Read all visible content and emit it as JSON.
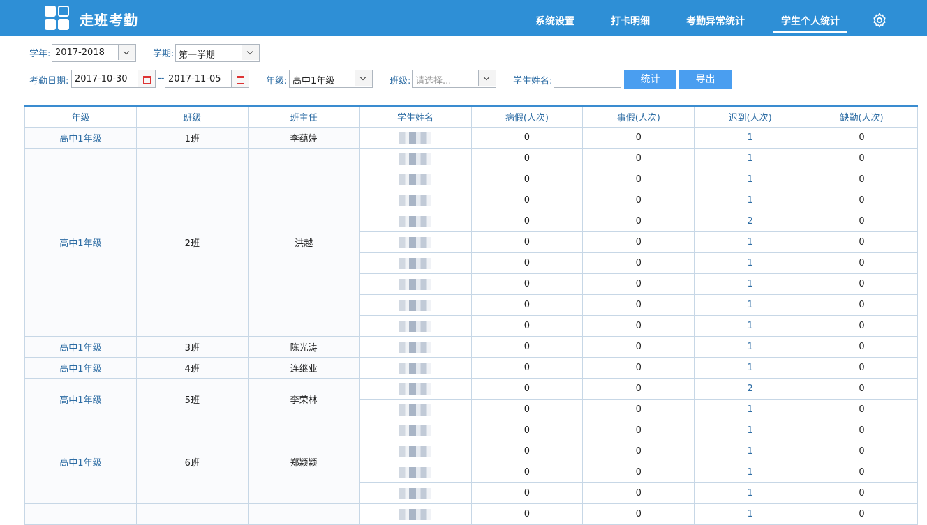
{
  "app": {
    "title": "走班考勤"
  },
  "nav": [
    {
      "label": "系统设置"
    },
    {
      "label": "打卡明细"
    },
    {
      "label": "考勤异常统计"
    },
    {
      "label": "学生个人统计"
    }
  ],
  "filters": {
    "year_label": "学年:",
    "year_value": "2017-2018",
    "term_label": "学期:",
    "term_value": "第一学期",
    "date_label": "考勤日期:",
    "date_start": "2017-10-30",
    "date_sep": "--",
    "date_end": "2017-11-05",
    "grade_label": "年级:",
    "grade_value": "高中1年级",
    "class_label": "班级:",
    "class_placeholder": "请选择...",
    "name_label": "学生姓名:"
  },
  "buttons": {
    "stat": "统计",
    "export": "导出"
  },
  "table": {
    "headers": [
      "年级",
      "班级",
      "班主任",
      "学生姓名",
      "病假(人次)",
      "事假(人次)",
      "迟到(人次)",
      "缺勤(人次)"
    ],
    "groups": [
      {
        "grade": "高中1年级",
        "class": "1班",
        "teacher": "李蕴婷",
        "rows": [
          [
            "0",
            "0",
            "1",
            "0"
          ]
        ]
      },
      {
        "grade": "高中1年级",
        "class": "2班",
        "teacher": "洪越",
        "rows": [
          [
            "0",
            "0",
            "1",
            "0"
          ],
          [
            "0",
            "0",
            "1",
            "0"
          ],
          [
            "0",
            "0",
            "1",
            "0"
          ],
          [
            "0",
            "0",
            "2",
            "0"
          ],
          [
            "0",
            "0",
            "1",
            "0"
          ],
          [
            "0",
            "0",
            "1",
            "0"
          ],
          [
            "0",
            "0",
            "1",
            "0"
          ],
          [
            "0",
            "0",
            "1",
            "0"
          ],
          [
            "0",
            "0",
            "1",
            "0"
          ]
        ]
      },
      {
        "grade": "高中1年级",
        "class": "3班",
        "teacher": "陈光涛",
        "rows": [
          [
            "0",
            "0",
            "1",
            "0"
          ]
        ]
      },
      {
        "grade": "高中1年级",
        "class": "4班",
        "teacher": "连继业",
        "rows": [
          [
            "0",
            "0",
            "1",
            "0"
          ]
        ]
      },
      {
        "grade": "高中1年级",
        "class": "5班",
        "teacher": "李荣林",
        "rows": [
          [
            "0",
            "0",
            "2",
            "0"
          ],
          [
            "0",
            "0",
            "1",
            "0"
          ]
        ]
      },
      {
        "grade": "高中1年级",
        "class": "6班",
        "teacher": "郑颖颖",
        "rows": [
          [
            "0",
            "0",
            "1",
            "0"
          ],
          [
            "0",
            "0",
            "1",
            "0"
          ],
          [
            "0",
            "0",
            "1",
            "0"
          ],
          [
            "0",
            "0",
            "1",
            "0"
          ]
        ]
      },
      {
        "grade": "",
        "class": "",
        "teacher": "",
        "rows": [
          [
            "0",
            "0",
            "1",
            "0"
          ]
        ]
      }
    ]
  },
  "colors": {
    "header_bg": "#2e8fd6",
    "button_bg": "#4a9ef0",
    "label": "#2e6da4"
  }
}
